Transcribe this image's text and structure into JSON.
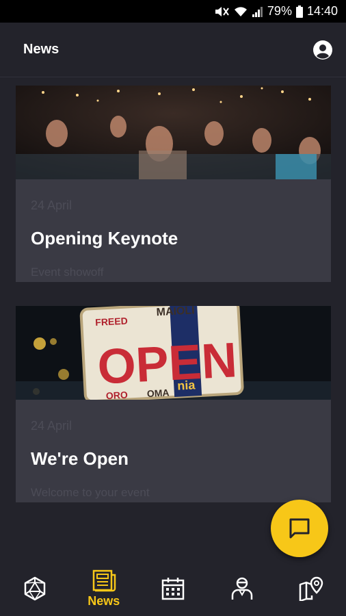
{
  "status": {
    "battery": "79%",
    "time": "14:40"
  },
  "app": {
    "title": "News"
  },
  "cards": [
    {
      "date": "24 April",
      "title": "Opening Keynote",
      "subtitle": "Event showoff"
    },
    {
      "date": "24 April",
      "title": "We're Open",
      "subtitle": "Welcome to your event",
      "image_text": [
        "FREED",
        "OPEN",
        "ORO",
        "OMA",
        "nia",
        "MAIOLI"
      ]
    }
  ],
  "nav": {
    "active_label": "News"
  },
  "colors": {
    "accent": "#f7c718",
    "background": "#23232b",
    "card": "#3a3a44"
  }
}
